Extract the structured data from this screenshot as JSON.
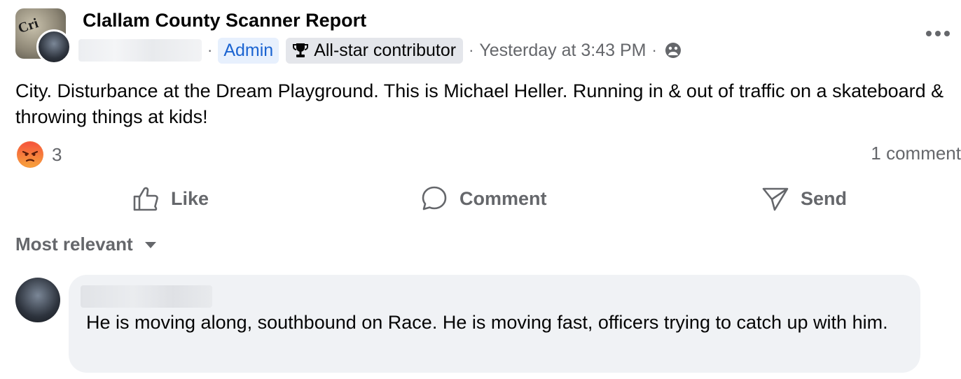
{
  "post": {
    "group_name": "Clallam County Scanner Report",
    "group_avatar_text": "Cri",
    "admin_badge": "Admin",
    "contributor_badge": "All-star contributor",
    "separator": "·",
    "timestamp": "Yesterday at 3:43 PM",
    "body": "City. Disturbance at the Dream Playground.  This is Michael Heller. Running in & out of traffic on a skateboard & throwing things at kids!",
    "reaction_count": "3",
    "comment_count": "1 comment"
  },
  "actions": {
    "like": "Like",
    "comment": "Comment",
    "send": "Send"
  },
  "comments": {
    "sort_label": "Most relevant",
    "items": [
      {
        "text": "He is moving along, southbound on Race. He is moving fast, officers trying to catch up with him."
      }
    ]
  },
  "icons": {
    "more": "more-options-icon",
    "trophy": "trophy-icon",
    "globe": "group-audience-icon",
    "reaction": "angry-reaction-icon",
    "like": "thumbs-up-icon",
    "comment": "comment-bubble-icon",
    "send": "send-icon",
    "sort": "caret-down-icon"
  },
  "colors": {
    "accent_blue": "#1b64d1",
    "muted_text": "#65676b",
    "angry_orange": "#f56b3f"
  }
}
